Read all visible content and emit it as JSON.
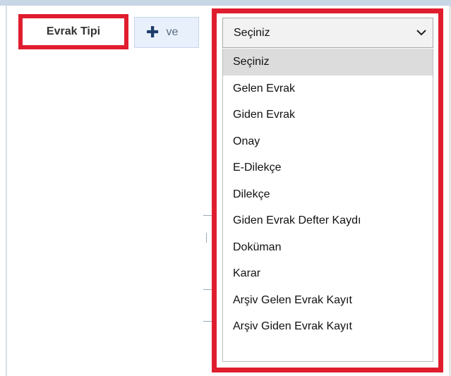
{
  "toolbar": {
    "evrak_tipi_label": "Evrak Tipi",
    "ve_button_label": "ve"
  },
  "select": {
    "value": "Seçiniz",
    "options": [
      "Seçiniz",
      "Gelen Evrak",
      "Giden Evrak",
      "Onay",
      "E-Dilekçe",
      "Dilekçe",
      "Giden Evrak Defter Kaydı",
      "Doküman",
      "Karar",
      "Arşiv Gelen Evrak Kayıt",
      "Arşiv Giden Evrak Kayıt"
    ],
    "selected_index": 0
  },
  "colors": {
    "highlight_border": "#e01d2f",
    "selected_option_bg": "#dcdcdc",
    "ve_button_bg": "#e8f0fb"
  },
  "icons": {
    "ve_button": "plus-icon",
    "select": "chevron-down-icon"
  }
}
